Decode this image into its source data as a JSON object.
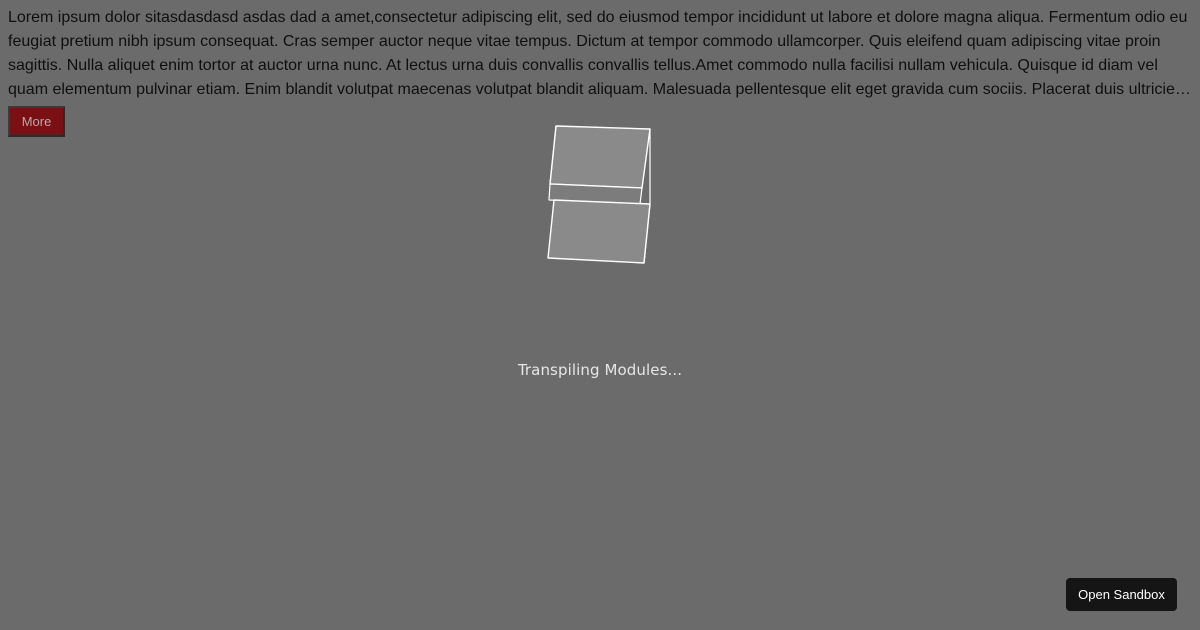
{
  "article": {
    "paragraph": "Lorem ipsum dolor sitasdasdasd asdas dad a amet,consectetur adipiscing elit, sed do eiusmod tempor incididunt ut labore et dolore magna aliqua. Fermentum odio eu feugiat pretium nibh ipsum consequat. Cras semper auctor neque vitae tempus. Dictum at tempor commodo ullamcorper. Quis eleifend quam adipiscing vitae proin sagittis. Nulla aliquet enim tortor at auctor urna nunc. At lectus urna duis convallis convallis tellus.Amet commodo nulla facilisi nullam vehicula. Quisque id diam vel quam elementum pulvinar etiam. Enim blandit volutpat maecenas volutpat blandit aliquam. Malesuada pellentesque elit eget gravida cum sociis. Placerat duis ultricies lacus sed",
    "more_label": "More"
  },
  "loader": {
    "status": "Transpiling Modules...",
    "icon": "cube-icon"
  },
  "sandbox": {
    "open_label": "Open Sandbox"
  },
  "colors": {
    "overlay_background": "#6b6b6b",
    "more_button": "#7a0f14",
    "open_sandbox_button": "#151515"
  }
}
